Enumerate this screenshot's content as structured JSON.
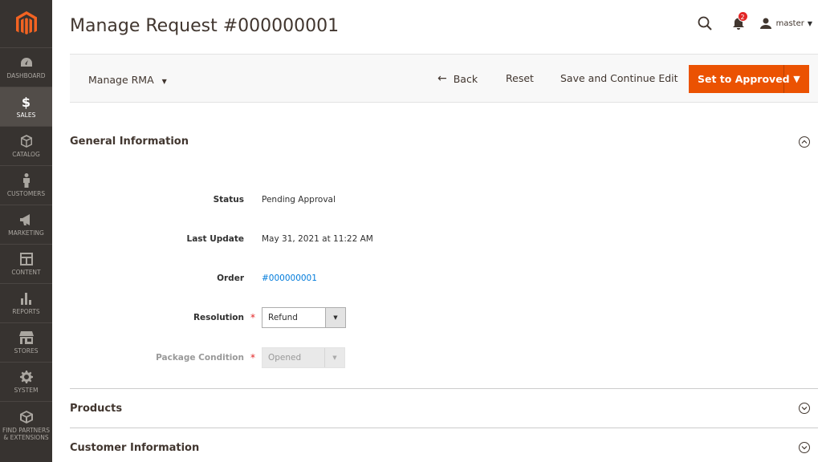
{
  "sidebar": {
    "items": [
      {
        "label": "DASHBOARD",
        "icon": "dashboard-icon"
      },
      {
        "label": "SALES",
        "icon": "dollar-icon",
        "active": true
      },
      {
        "label": "CATALOG",
        "icon": "cube-icon"
      },
      {
        "label": "CUSTOMERS",
        "icon": "person-icon"
      },
      {
        "label": "MARKETING",
        "icon": "megaphone-icon"
      },
      {
        "label": "CONTENT",
        "icon": "layout-icon"
      },
      {
        "label": "REPORTS",
        "icon": "bar-chart-icon"
      },
      {
        "label": "STORES",
        "icon": "storefront-icon"
      },
      {
        "label": "SYSTEM",
        "icon": "gear-icon"
      },
      {
        "label": "FIND PARTNERS & EXTENSIONS",
        "icon": "box-icon"
      }
    ]
  },
  "header": {
    "title": "Manage Request #000000001",
    "notifications_count": "2",
    "user_name": "master"
  },
  "action_bar": {
    "manage_rma": "Manage RMA",
    "back": "Back",
    "reset": "Reset",
    "save_continue": "Save and Continue Edit",
    "primary": "Set to Approved"
  },
  "general": {
    "title": "General Information",
    "status_label": "Status",
    "status_value": "Pending Approval",
    "last_update_label": "Last Update",
    "last_update_value": "May 31, 2021 at 11:22 AM",
    "order_label": "Order",
    "order_value": "#000000001",
    "resolution_label": "Resolution",
    "resolution_value": "Refund",
    "package_label": "Package Condition",
    "package_value": "Opened"
  },
  "sections": {
    "products": "Products",
    "customer": "Customer Information"
  },
  "colors": {
    "primary": "#eb5202",
    "sidebar": "#373330",
    "link": "#007bdb"
  }
}
